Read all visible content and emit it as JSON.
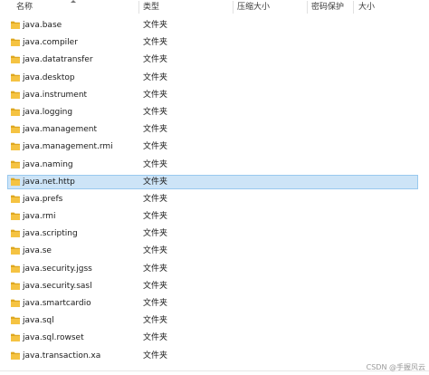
{
  "columns": {
    "name": "名称",
    "type": "类型",
    "compressed_size": "压缩大小",
    "password_protected": "密码保护",
    "size": "大小"
  },
  "files": [
    {
      "name": "java.base",
      "type": "文件夹"
    },
    {
      "name": "java.compiler",
      "type": "文件夹"
    },
    {
      "name": "java.datatransfer",
      "type": "文件夹"
    },
    {
      "name": "java.desktop",
      "type": "文件夹"
    },
    {
      "name": "java.instrument",
      "type": "文件夹"
    },
    {
      "name": "java.logging",
      "type": "文件夹"
    },
    {
      "name": "java.management",
      "type": "文件夹"
    },
    {
      "name": "java.management.rmi",
      "type": "文件夹"
    },
    {
      "name": "java.naming",
      "type": "文件夹"
    },
    {
      "name": "java.net.http",
      "type": "文件夹"
    },
    {
      "name": "java.prefs",
      "type": "文件夹"
    },
    {
      "name": "java.rmi",
      "type": "文件夹"
    },
    {
      "name": "java.scripting",
      "type": "文件夹"
    },
    {
      "name": "java.se",
      "type": "文件夹"
    },
    {
      "name": "java.security.jgss",
      "type": "文件夹"
    },
    {
      "name": "java.security.sasl",
      "type": "文件夹"
    },
    {
      "name": "java.smartcardio",
      "type": "文件夹"
    },
    {
      "name": "java.sql",
      "type": "文件夹"
    },
    {
      "name": "java.sql.rowset",
      "type": "文件夹"
    },
    {
      "name": "java.transaction.xa",
      "type": "文件夹"
    }
  ],
  "selected_file": "java.net.http",
  "folder_icon": "folder-icon",
  "colors": {
    "selection_fill": "#cde4f7",
    "selection_border": "#99c9ef",
    "folder_yellow": "#f5c342",
    "folder_yellow_dark": "#dea71f"
  },
  "watermark": "CSDN @手握风云"
}
